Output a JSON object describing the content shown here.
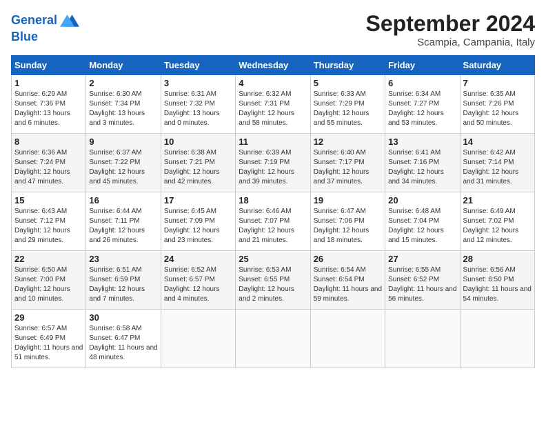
{
  "header": {
    "logo_line1": "General",
    "logo_line2": "Blue",
    "month_year": "September 2024",
    "location": "Scampia, Campania, Italy"
  },
  "weekdays": [
    "Sunday",
    "Monday",
    "Tuesday",
    "Wednesday",
    "Thursday",
    "Friday",
    "Saturday"
  ],
  "weeks": [
    [
      {
        "day": "1",
        "sunrise": "Sunrise: 6:29 AM",
        "sunset": "Sunset: 7:36 PM",
        "daylight": "Daylight: 13 hours and 6 minutes."
      },
      {
        "day": "2",
        "sunrise": "Sunrise: 6:30 AM",
        "sunset": "Sunset: 7:34 PM",
        "daylight": "Daylight: 13 hours and 3 minutes."
      },
      {
        "day": "3",
        "sunrise": "Sunrise: 6:31 AM",
        "sunset": "Sunset: 7:32 PM",
        "daylight": "Daylight: 13 hours and 0 minutes."
      },
      {
        "day": "4",
        "sunrise": "Sunrise: 6:32 AM",
        "sunset": "Sunset: 7:31 PM",
        "daylight": "Daylight: 12 hours and 58 minutes."
      },
      {
        "day": "5",
        "sunrise": "Sunrise: 6:33 AM",
        "sunset": "Sunset: 7:29 PM",
        "daylight": "Daylight: 12 hours and 55 minutes."
      },
      {
        "day": "6",
        "sunrise": "Sunrise: 6:34 AM",
        "sunset": "Sunset: 7:27 PM",
        "daylight": "Daylight: 12 hours and 53 minutes."
      },
      {
        "day": "7",
        "sunrise": "Sunrise: 6:35 AM",
        "sunset": "Sunset: 7:26 PM",
        "daylight": "Daylight: 12 hours and 50 minutes."
      }
    ],
    [
      {
        "day": "8",
        "sunrise": "Sunrise: 6:36 AM",
        "sunset": "Sunset: 7:24 PM",
        "daylight": "Daylight: 12 hours and 47 minutes."
      },
      {
        "day": "9",
        "sunrise": "Sunrise: 6:37 AM",
        "sunset": "Sunset: 7:22 PM",
        "daylight": "Daylight: 12 hours and 45 minutes."
      },
      {
        "day": "10",
        "sunrise": "Sunrise: 6:38 AM",
        "sunset": "Sunset: 7:21 PM",
        "daylight": "Daylight: 12 hours and 42 minutes."
      },
      {
        "day": "11",
        "sunrise": "Sunrise: 6:39 AM",
        "sunset": "Sunset: 7:19 PM",
        "daylight": "Daylight: 12 hours and 39 minutes."
      },
      {
        "day": "12",
        "sunrise": "Sunrise: 6:40 AM",
        "sunset": "Sunset: 7:17 PM",
        "daylight": "Daylight: 12 hours and 37 minutes."
      },
      {
        "day": "13",
        "sunrise": "Sunrise: 6:41 AM",
        "sunset": "Sunset: 7:16 PM",
        "daylight": "Daylight: 12 hours and 34 minutes."
      },
      {
        "day": "14",
        "sunrise": "Sunrise: 6:42 AM",
        "sunset": "Sunset: 7:14 PM",
        "daylight": "Daylight: 12 hours and 31 minutes."
      }
    ],
    [
      {
        "day": "15",
        "sunrise": "Sunrise: 6:43 AM",
        "sunset": "Sunset: 7:12 PM",
        "daylight": "Daylight: 12 hours and 29 minutes."
      },
      {
        "day": "16",
        "sunrise": "Sunrise: 6:44 AM",
        "sunset": "Sunset: 7:11 PM",
        "daylight": "Daylight: 12 hours and 26 minutes."
      },
      {
        "day": "17",
        "sunrise": "Sunrise: 6:45 AM",
        "sunset": "Sunset: 7:09 PM",
        "daylight": "Daylight: 12 hours and 23 minutes."
      },
      {
        "day": "18",
        "sunrise": "Sunrise: 6:46 AM",
        "sunset": "Sunset: 7:07 PM",
        "daylight": "Daylight: 12 hours and 21 minutes."
      },
      {
        "day": "19",
        "sunrise": "Sunrise: 6:47 AM",
        "sunset": "Sunset: 7:06 PM",
        "daylight": "Daylight: 12 hours and 18 minutes."
      },
      {
        "day": "20",
        "sunrise": "Sunrise: 6:48 AM",
        "sunset": "Sunset: 7:04 PM",
        "daylight": "Daylight: 12 hours and 15 minutes."
      },
      {
        "day": "21",
        "sunrise": "Sunrise: 6:49 AM",
        "sunset": "Sunset: 7:02 PM",
        "daylight": "Daylight: 12 hours and 12 minutes."
      }
    ],
    [
      {
        "day": "22",
        "sunrise": "Sunrise: 6:50 AM",
        "sunset": "Sunset: 7:00 PM",
        "daylight": "Daylight: 12 hours and 10 minutes."
      },
      {
        "day": "23",
        "sunrise": "Sunrise: 6:51 AM",
        "sunset": "Sunset: 6:59 PM",
        "daylight": "Daylight: 12 hours and 7 minutes."
      },
      {
        "day": "24",
        "sunrise": "Sunrise: 6:52 AM",
        "sunset": "Sunset: 6:57 PM",
        "daylight": "Daylight: 12 hours and 4 minutes."
      },
      {
        "day": "25",
        "sunrise": "Sunrise: 6:53 AM",
        "sunset": "Sunset: 6:55 PM",
        "daylight": "Daylight: 12 hours and 2 minutes."
      },
      {
        "day": "26",
        "sunrise": "Sunrise: 6:54 AM",
        "sunset": "Sunset: 6:54 PM",
        "daylight": "Daylight: 11 hours and 59 minutes."
      },
      {
        "day": "27",
        "sunrise": "Sunrise: 6:55 AM",
        "sunset": "Sunset: 6:52 PM",
        "daylight": "Daylight: 11 hours and 56 minutes."
      },
      {
        "day": "28",
        "sunrise": "Sunrise: 6:56 AM",
        "sunset": "Sunset: 6:50 PM",
        "daylight": "Daylight: 11 hours and 54 minutes."
      }
    ],
    [
      {
        "day": "29",
        "sunrise": "Sunrise: 6:57 AM",
        "sunset": "Sunset: 6:49 PM",
        "daylight": "Daylight: 11 hours and 51 minutes."
      },
      {
        "day": "30",
        "sunrise": "Sunrise: 6:58 AM",
        "sunset": "Sunset: 6:47 PM",
        "daylight": "Daylight: 11 hours and 48 minutes."
      },
      null,
      null,
      null,
      null,
      null
    ]
  ]
}
